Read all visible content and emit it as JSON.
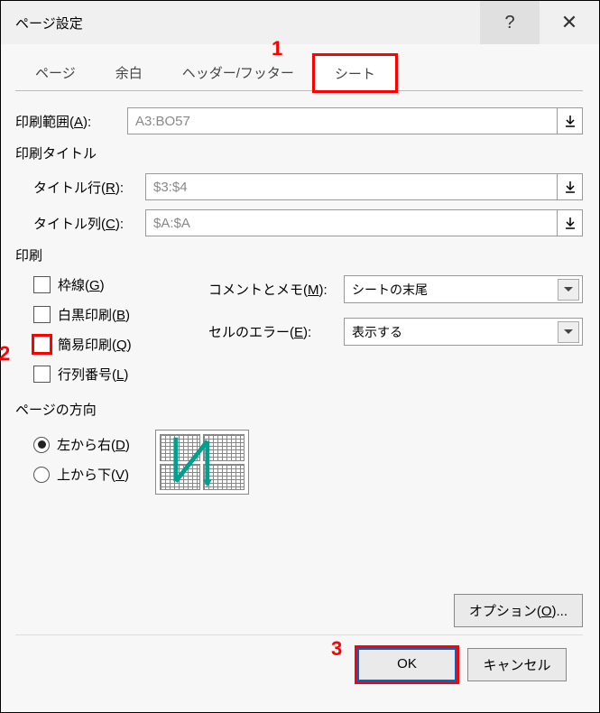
{
  "title": "ページ設定",
  "annotations": {
    "a1": "1",
    "a2": "2",
    "a3": "3"
  },
  "tabs": {
    "page": "ページ",
    "margins": "余白",
    "headerfooter": "ヘッダー/フッター",
    "sheet": "シート"
  },
  "printArea": {
    "label": "印刷範囲(A):",
    "value": "A3:BO57"
  },
  "printTitles": {
    "label": "印刷タイトル",
    "rows": {
      "label": "タイトル行(R):",
      "value": "$3:$4"
    },
    "cols": {
      "label": "タイトル列(C):",
      "value": "$A:$A"
    }
  },
  "print": {
    "label": "印刷",
    "gridlines": "枠線(G)",
    "blackwhite": "白黒印刷(B)",
    "draft": "簡易印刷(Q)",
    "rowcol": "行列番号(L)",
    "comments": {
      "label": "コメントとメモ(M):",
      "value": "シートの末尾"
    },
    "errors": {
      "label": "セルのエラー(E):",
      "value": "表示する"
    }
  },
  "pageOrder": {
    "label": "ページの方向",
    "ltr": "左から右(D)",
    "ttb": "上から下(V)"
  },
  "buttons": {
    "options": "オプション(O)...",
    "ok": "OK",
    "cancel": "キャンセル"
  }
}
